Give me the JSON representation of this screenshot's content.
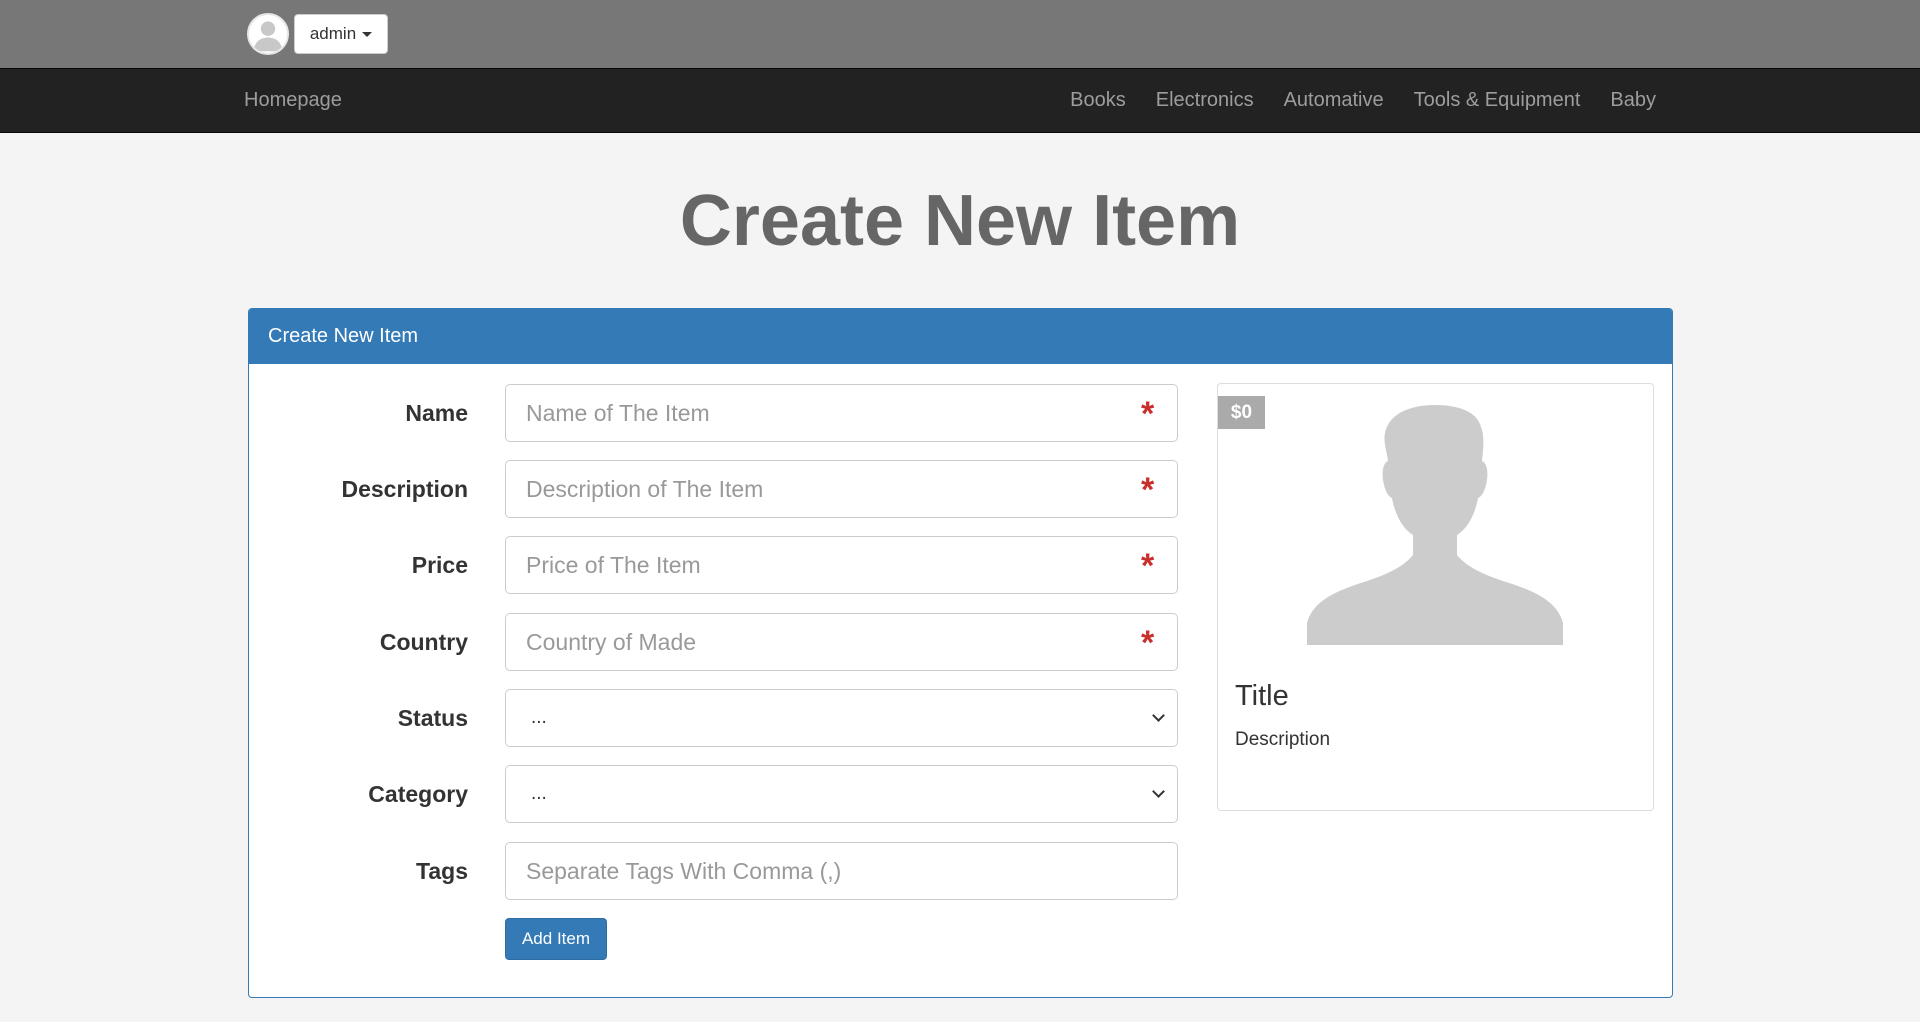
{
  "topbar": {
    "user_label": "admin",
    "avatar_icon": "user-avatar-icon"
  },
  "navbar": {
    "brand": "Homepage",
    "links": [
      "Books",
      "Electronics",
      "Automative",
      "Tools & Equipment",
      "Baby"
    ]
  },
  "page": {
    "title": "Create New Item"
  },
  "panel": {
    "heading": "Create New Item",
    "fields": {
      "name": {
        "label": "Name",
        "placeholder": "Name of The Item",
        "value": "",
        "required": "*"
      },
      "description": {
        "label": "Description",
        "placeholder": "Description of The Item",
        "value": "",
        "required": "*"
      },
      "price": {
        "label": "Price",
        "placeholder": "Price of The Item",
        "value": "",
        "required": "*"
      },
      "country": {
        "label": "Country",
        "placeholder": "Country of Made",
        "value": "",
        "required": "*"
      },
      "status": {
        "label": "Status",
        "selected": "..."
      },
      "category": {
        "label": "Category",
        "selected": "..."
      },
      "tags": {
        "label": "Tags",
        "placeholder": "Separate Tags With Comma (,)",
        "value": ""
      }
    },
    "submit_label": "Add Item"
  },
  "preview": {
    "price": "$0",
    "title": "Title",
    "description": "Description",
    "image_icon": "person-silhouette-icon"
  },
  "colors": {
    "userbar_bg": "#777777",
    "navbar_bg": "#222222",
    "primary": "#337ab7",
    "required": "#c9302c",
    "badge_bg": "#aaaaaa"
  }
}
